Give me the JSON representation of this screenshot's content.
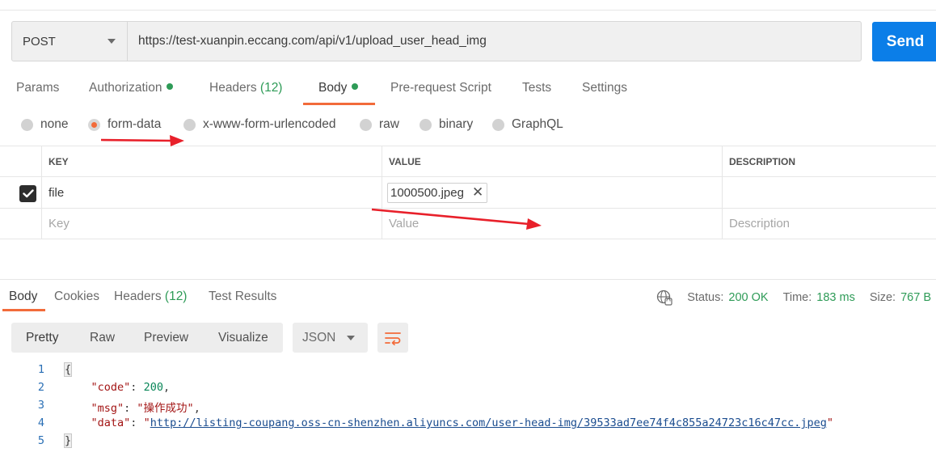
{
  "request": {
    "method": "POST",
    "url": "https://test-xuanpin.eccang.com/api/v1/upload_user_head_img",
    "send_label": "Send"
  },
  "tabs": {
    "params": "Params",
    "authorization": "Authorization",
    "headers": "Headers",
    "headers_count": "(12)",
    "body": "Body",
    "prerequest": "Pre-request Script",
    "tests": "Tests",
    "settings": "Settings"
  },
  "body_types": {
    "none": "none",
    "form_data": "form-data",
    "urlencoded": "x-www-form-urlencoded",
    "raw": "raw",
    "binary": "binary",
    "graphql": "GraphQL",
    "selected": "form-data"
  },
  "params_table": {
    "headers": {
      "key": "KEY",
      "value": "VALUE",
      "description": "DESCRIPTION"
    },
    "rows": [
      {
        "checked": true,
        "key": "file",
        "value": "1000500.jpeg",
        "description": ""
      }
    ],
    "placeholders": {
      "key": "Key",
      "value": "Value",
      "description": "Description"
    }
  },
  "response": {
    "tabs": {
      "body": "Body",
      "cookies": "Cookies",
      "headers": "Headers",
      "headers_count": "(12)",
      "test_results": "Test Results"
    },
    "status_label": "Status:",
    "status_value": "200 OK",
    "time_label": "Time:",
    "time_value": "183 ms",
    "size_label": "Size:",
    "size_value": "767 B",
    "format_tabs": {
      "pretty": "Pretty",
      "raw": "Raw",
      "preview": "Preview",
      "visualize": "Visualize"
    },
    "language": "JSON",
    "code": {
      "line_numbers": [
        "1",
        "2",
        "3",
        "4",
        "5"
      ],
      "open_brace": "{",
      "close_brace": "}",
      "code_key": "\"code\"",
      "code_value": "200",
      "msg_key": "\"msg\"",
      "msg_value": "\"操作成功\"",
      "data_key": "\"data\"",
      "data_value": "http://listing-coupang.oss-cn-shenzhen.aliyuncs.com/user-head-img/39533ad7ee74f4c855a24723c16c47cc.jpeg"
    }
  },
  "colors": {
    "accent": "#f26b3a",
    "send_button": "#0b7ee8",
    "status_green": "#2e9b57",
    "annotation_arrow": "#e8202a"
  }
}
